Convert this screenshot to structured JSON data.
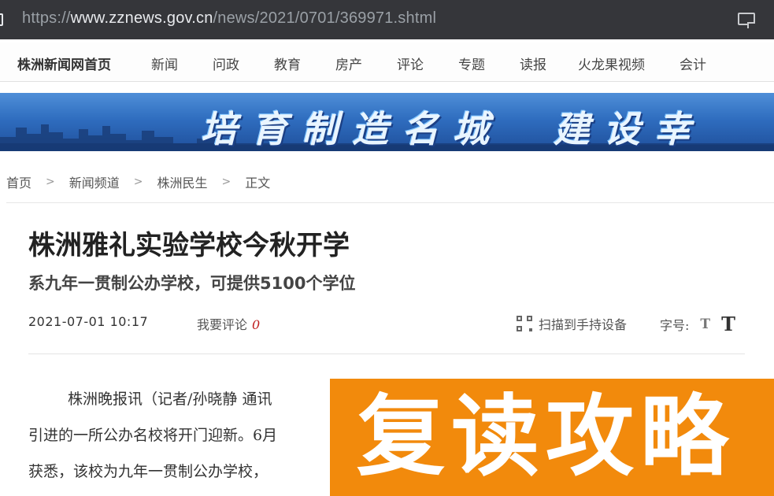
{
  "browser": {
    "url_scheme": "https://",
    "url_host": "www.zznews.gov.cn",
    "url_path": "/news/2021/0701/369971.shtml"
  },
  "nav": {
    "home": "株洲新闻网首页",
    "items": [
      "新闻",
      "问政",
      "教育",
      "房产",
      "评论",
      "专题",
      "读报",
      "火龙果视频",
      "会计"
    ]
  },
  "banner": {
    "slogan": "培育制造名城　建设幸"
  },
  "breadcrumb": [
    "首页",
    "新闻频道",
    "株洲民生",
    "正文"
  ],
  "breadcrumb_separator": ">",
  "article": {
    "title": "株洲雅礼实验学校今秋开学",
    "subtitle": "系九年一贯制公办学校，可提供5100个学位",
    "date": "2021-07-01 10:17",
    "comment_label": "我要评论",
    "comment_count": "0",
    "scan_label": "扫描到手持设备",
    "fontsize_label": "字号:",
    "font_small": "T",
    "font_large": "T",
    "paragraphs": [
      "株洲晚报讯（记者/孙晓静 通讯",
      "引进的一所公办名校将开门迎新。6月",
      "获悉，该校为九年一贯制公办学校，"
    ]
  },
  "overlay": {
    "text": "复读攻略",
    "color": "#f28a0c"
  },
  "colors": {
    "urlbar_bg": "#35363a",
    "comment_count": "#c02020"
  }
}
